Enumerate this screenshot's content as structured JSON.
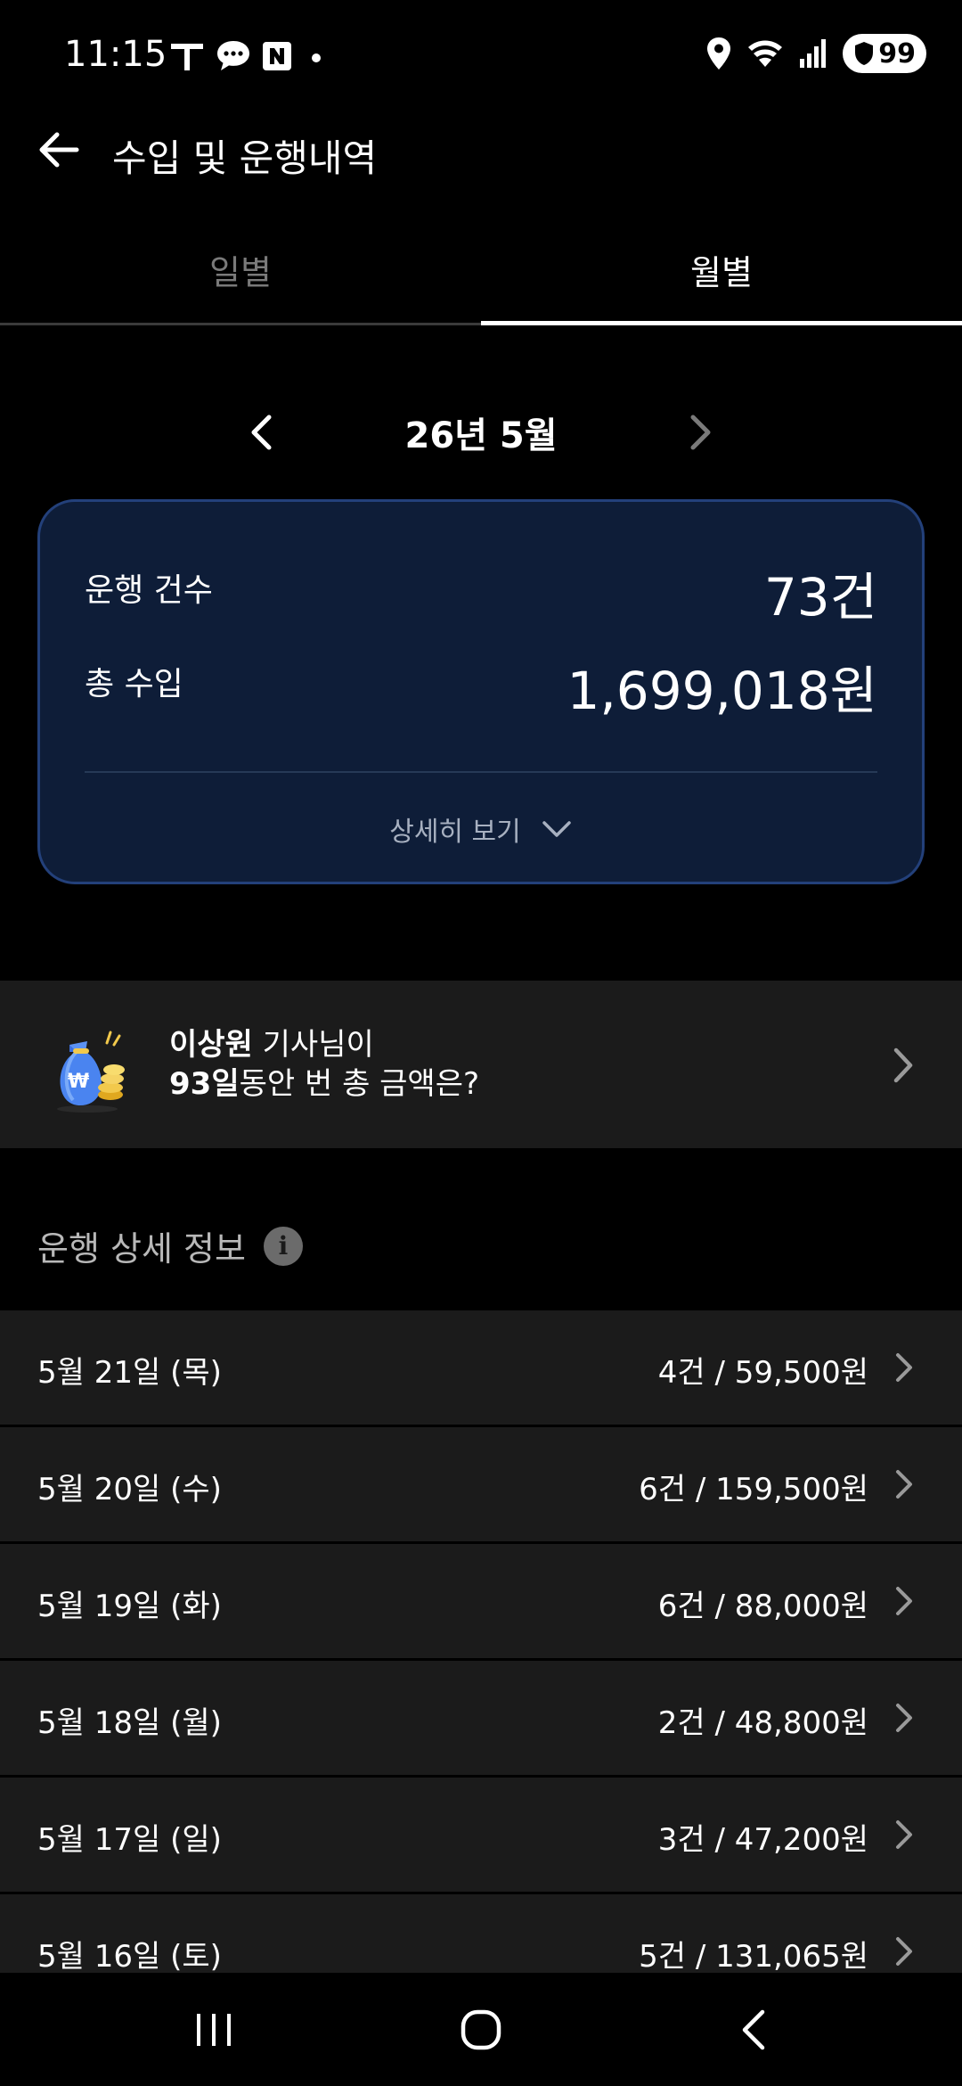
{
  "status_bar": {
    "time": "11:15",
    "left_icons": [
      "tmap-icon",
      "chat-icon",
      "naver-icon",
      "dot-icon"
    ],
    "right_icons": [
      "location-icon",
      "wifi-icon",
      "signal-icon"
    ],
    "battery": "99"
  },
  "header": {
    "title": "수입 및 운행내역"
  },
  "tabs": [
    {
      "label": "일별",
      "active": false
    },
    {
      "label": "월별",
      "active": true
    }
  ],
  "month_nav": {
    "label": "26년 5월"
  },
  "summary": {
    "trip_count_label": "운행 건수",
    "trip_count_value": "73건",
    "income_label": "총 수입",
    "income_value": "1,699,018원",
    "detail_toggle_label": "상세히 보기"
  },
  "promo": {
    "name": "이상원",
    "line1_suffix": " 기사님이",
    "days": "93일",
    "line2_suffix": "동안 번 총 금액은?"
  },
  "section": {
    "title": "운행 상세 정보"
  },
  "trips": [
    {
      "date": "5월 21일 (목)",
      "summary": "4건 / 59,500원"
    },
    {
      "date": "5월 20일 (수)",
      "summary": "6건 / 159,500원"
    },
    {
      "date": "5월 19일 (화)",
      "summary": "6건 / 88,000원"
    },
    {
      "date": "5월 18일 (월)",
      "summary": "2건 / 48,800원"
    },
    {
      "date": "5월 17일 (일)",
      "summary": "3건 / 47,200원"
    },
    {
      "date": "5월 16일 (토)",
      "summary": "5건 / 131,065원"
    }
  ],
  "colors": {
    "background": "#000000",
    "card_bg": "#0e1d38",
    "card_border": "#23407a",
    "row_bg": "#1b1b1b"
  }
}
